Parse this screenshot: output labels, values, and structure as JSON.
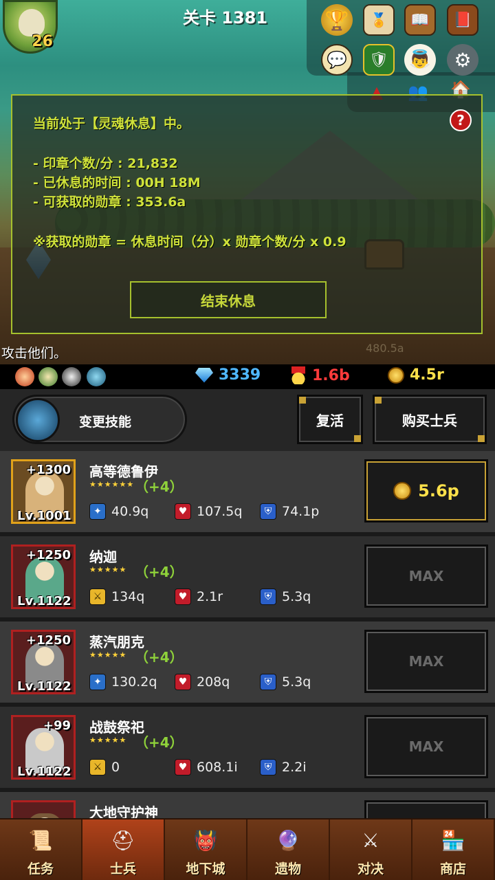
{
  "header": {
    "stage_title": "关卡 1381",
    "player_level": "26"
  },
  "top_icons": [
    {
      "name": "trophy-icon",
      "glyph": "🏆"
    },
    {
      "name": "ranking-icon",
      "glyph": "🏅"
    },
    {
      "name": "book-icon",
      "glyph": "📖"
    },
    {
      "name": "quest-book-icon",
      "glyph": "📕"
    },
    {
      "name": "chat-icon",
      "glyph": "💬"
    },
    {
      "name": "guild-shield-icon",
      "glyph": "🛡"
    },
    {
      "name": "angel-icon",
      "glyph": "👼"
    },
    {
      "name": "gear-icon",
      "glyph": "⚙"
    },
    {
      "name": "warning-icon",
      "glyph": "▲"
    },
    {
      "name": "friends-icon",
      "glyph": "👥"
    },
    {
      "name": "house-icon",
      "glyph": "🏠"
    }
  ],
  "rest_dialog": {
    "status": "当前处于【灵魂休息】中。",
    "seals_per_min": "- 印章个数/分 : 21,832",
    "rest_time": "- 已休息的时间 : 00H 18M",
    "medals": "- 可获取的勋章 : 353.6a",
    "formula": "※获取的勋章 = 休息时间（分）x 勋章个数/分 x 0.9",
    "end_button": "结束休息",
    "help": "?"
  },
  "chat": {
    "message": "攻击他们。",
    "faded_value": "480.5a"
  },
  "resources": {
    "gems": "3339",
    "medals": "1.6b",
    "gold": "4.5r",
    "colors": {
      "gems": "#4fb8ff",
      "medals": "#ff3b3b",
      "gold": "#ffe14a"
    }
  },
  "controls": {
    "skill_label": "变更技能",
    "revive_label": "复活",
    "buy_soldier_label": "购买士兵"
  },
  "units": [
    {
      "name": "高等德鲁伊",
      "bonus": "+1300",
      "level": "Lv.1001",
      "stars": "★★★★★★",
      "plus": "（+4）",
      "atk": "40.9q",
      "hp": "107.5q",
      "def": "74.1p",
      "atk_type": "staff",
      "price": "5.6p",
      "maxed": false,
      "frame": "gold",
      "body_color": "#d8b27a"
    },
    {
      "name": "纳迦",
      "bonus": "+1250",
      "level": "Lv.1122",
      "stars": "★★★★★",
      "plus": "（+4）",
      "atk": "134q",
      "hp": "2.1r",
      "def": "5.3q",
      "atk_type": "sword",
      "price": "MAX",
      "maxed": true,
      "frame": "red",
      "body_color": "#5aa88a"
    },
    {
      "name": "蒸汽朋克",
      "bonus": "+1250",
      "level": "Lv.1122",
      "stars": "★★★★★",
      "plus": "（+4）",
      "atk": "130.2q",
      "hp": "208q",
      "def": "5.3q",
      "atk_type": "staff",
      "price": "MAX",
      "maxed": true,
      "frame": "red",
      "body_color": "#8a8a8a"
    },
    {
      "name": "战鼓祭祀",
      "bonus": "+99",
      "level": "Lv.1122",
      "stars": "★★★★★",
      "plus": "（+4）",
      "atk": "0",
      "hp": "608.1i",
      "def": "2.2i",
      "atk_type": "sword",
      "price": "MAX",
      "maxed": true,
      "frame": "red",
      "body_color": "#c9c9c9"
    },
    {
      "name": "大地守护神",
      "bonus": "",
      "level": "",
      "stars": "",
      "plus": "",
      "atk": "",
      "hp": "",
      "def": "",
      "atk_type": "sword",
      "price": "",
      "maxed": true,
      "frame": "red",
      "body_color": "#7a5a3a"
    }
  ],
  "bottom_nav": [
    {
      "label": "任务",
      "icon": "scroll-icon",
      "glyph": "📜",
      "active": false
    },
    {
      "label": "士兵",
      "icon": "soldier-helmet-icon",
      "glyph": "⛑",
      "active": true
    },
    {
      "label": "地下城",
      "icon": "monster-icon",
      "glyph": "👹",
      "active": false
    },
    {
      "label": "遗物",
      "icon": "relic-orb-icon",
      "glyph": "🔮",
      "active": false
    },
    {
      "label": "对决",
      "icon": "crossed-swords-icon",
      "glyph": "⚔",
      "active": false
    },
    {
      "label": "商店",
      "icon": "shop-icon",
      "glyph": "🏪",
      "active": false
    }
  ]
}
